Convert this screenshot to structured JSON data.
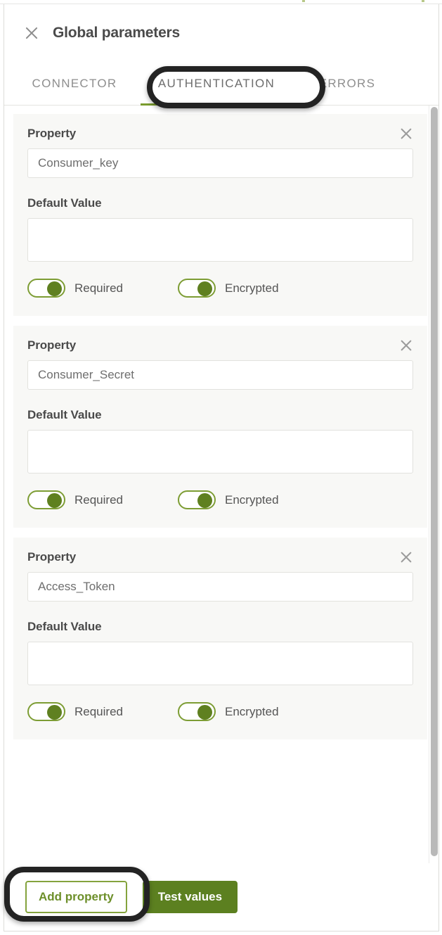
{
  "header": {
    "title": "Global parameters",
    "close_icon": "close-x-icon"
  },
  "tabs": [
    {
      "label": "CONNECTOR",
      "active": false
    },
    {
      "label": "AUTHENTICATION",
      "active": true
    },
    {
      "label": "ERRORS",
      "active": false
    }
  ],
  "labels": {
    "property": "Property",
    "default_value": "Default Value",
    "required": "Required",
    "encrypted": "Encrypted"
  },
  "properties": [
    {
      "name": "Consumer_key",
      "default_value": "",
      "default_value_placeholder": "",
      "required": true,
      "encrypted": true,
      "remove_icon": "close-x-icon"
    },
    {
      "name": "Consumer_Secret",
      "default_value": "",
      "default_value_placeholder": "",
      "required": true,
      "encrypted": true,
      "remove_icon": "close-x-icon"
    },
    {
      "name": "Access_Token",
      "default_value": "",
      "default_value_placeholder": "",
      "required": true,
      "encrypted": true,
      "remove_icon": "close-x-icon"
    }
  ],
  "actions": {
    "add_property": "Add property",
    "test_values": "Test values"
  },
  "colors": {
    "accent_green": "#5c8020",
    "outline_green": "#84a33d",
    "toggle_green": "#5f8020",
    "tab_indicator": "#7a9c2e",
    "card_bg": "#f8f8f6",
    "annotation": "#232323"
  }
}
